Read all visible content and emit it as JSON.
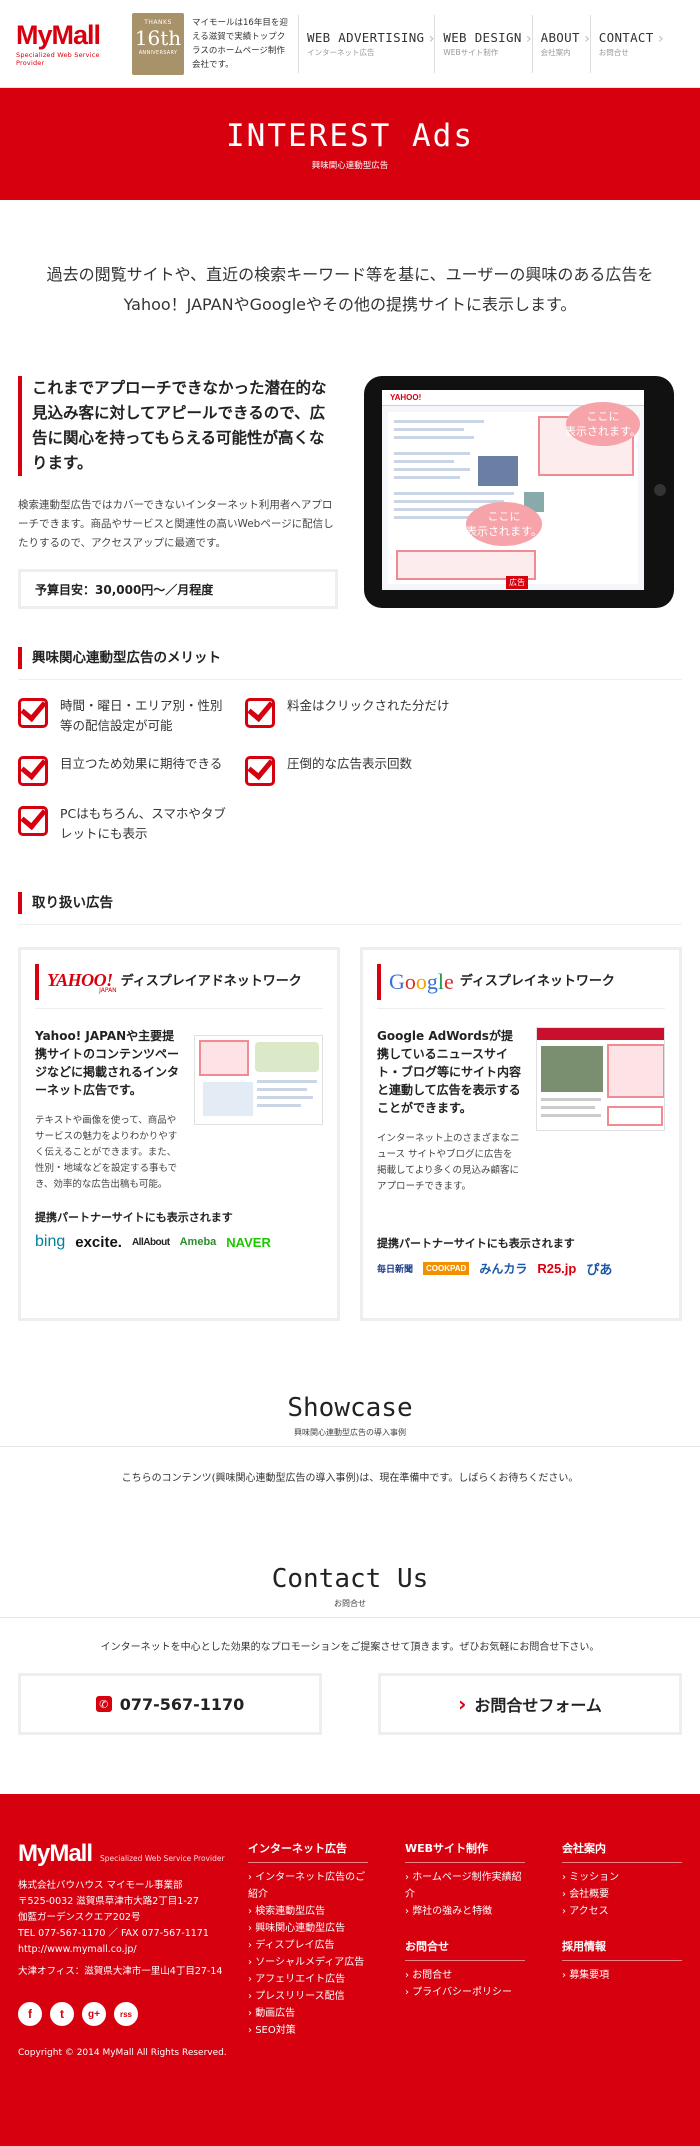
{
  "header": {
    "logo": "MyMall",
    "logo_tagline": "Specialized Web Service Provider",
    "badge": {
      "line1": "THANKS",
      "number": "16th",
      "line3": "ANNIVERSARY"
    },
    "description": "マイモールは16年目を迎える滋賀で実績トップクラスのホームページ制作会社です。",
    "nav": [
      {
        "en": "WEB ADVERTISING",
        "ja": "インターネット広告"
      },
      {
        "en": "WEB DESIGN",
        "ja": "WEBサイト制作"
      },
      {
        "en": "ABOUT",
        "ja": "会社案内"
      },
      {
        "en": "CONTACT",
        "ja": "お問合せ"
      }
    ]
  },
  "hero": {
    "title": "INTEREST Ads",
    "subtitle": "興味関心連動型広告"
  },
  "lead": {
    "line1": "過去の閲覧サイトや、直近の検索キーワード等を基に、ユーザーの興味のある広告を",
    "line2": "Yahoo！JAPANやGoogleやその他の提携サイトに表示します。"
  },
  "intro": {
    "heading": "これまでアプローチできなかった潜在的な見込み客に対してアピールできるので、広告に関心を持ってもらえる可能性が高くなります。",
    "text": "検索連動型広告ではカバーできないインターネット利用者へアプローチできます。商品やサービスと関連性の高いWebページに配信したりするので、アクセスアップに最適です。",
    "budget": "予算目安：30,000円〜／月程度",
    "bubble1": "ここに\n表示されます。",
    "bubble2": "ここに\n表示されます。",
    "ad_tag": "広告"
  },
  "merits": {
    "title": "興味関心連動型広告のメリット",
    "items": [
      "時間・曜日・エリア別・性別等の配信設定が可能",
      "料金はクリックされた分だけ",
      "目立つため効果に期待できる",
      "圧倒的な広告表示回数",
      "PCはもちろん、スマホやタブレットにも表示"
    ]
  },
  "handling": {
    "title": "取り扱い広告",
    "yahoo": {
      "logo": "YAHOO!",
      "logo_sub": "JAPAN",
      "title": "ディスプレイアドネットワーク",
      "strong": "Yahoo! JAPANや主要提携サイトのコンテンツページなどに掲載されるインターネット広告です。",
      "small": "テキストや画像を使って、商品やサービスの魅力をよりわかりやすく伝えることができます。また、性別・地域などを設定する事もでき、効率的な広告出稿も可能。",
      "partners_title": "提携パートナーサイトにも表示されます",
      "partners": [
        "bing",
        "excite.",
        "AllAbout",
        "Ameba",
        "NAVER"
      ]
    },
    "google": {
      "logo": "Google",
      "title": "ディスプレイネットワーク",
      "strong": "Google AdWordsが提携しているニュースサイト・ブログ等にサイト内容と連動して広告を表示することができます。",
      "small": "インターネット上のさまざまなニュース サイトやブログに広告を掲載してより多くの見込み顧客にアプローチできます。",
      "partners_title": "提携パートナーサイトにも表示されます",
      "partners": [
        "毎日新聞",
        "COOKPAD",
        "みんカラ",
        "R25.jp",
        "ぴあ"
      ]
    }
  },
  "showcase": {
    "title": "Showcase",
    "subtitle": "興味関心連動型広告の導入事例",
    "text": "こちらのコンテンツ(興味関心連動型広告の導入事例)は、現在準備中です。しばらくお待ちください。"
  },
  "contact": {
    "title": "Contact Us",
    "subtitle": "お問合せ",
    "text": "インターネットを中心とした効果的なプロモーションをご提案させて頂きます。ぜひお気軽にお問合せ下さい。",
    "phone": "077-567-1170",
    "form": "お問合せフォーム"
  },
  "footer": {
    "logo": "MyMall",
    "tagline": "Specialized Web Service Provider",
    "address": [
      "株式会社バウハウス マイモール事業部",
      "〒525-0032 滋賀県草津市大路2丁目1-27",
      "伽藍ガーデンスクエア202号",
      "TEL 077-567-1170 ／ FAX 077-567-1171",
      "http://www.mymall.co.jp/"
    ],
    "office": "大津オフィス：滋賀県大津市一里山4丁目27-14",
    "social": [
      "f",
      "t",
      "g+",
      "rss"
    ],
    "copyright": "Copyright © 2014 MyMall All Rights Reserved.",
    "col1": {
      "title": "インターネット広告",
      "items": [
        "インターネット広告のご紹介",
        "検索連動型広告",
        "興味関心連動型広告",
        "ディスプレイ広告",
        "ソーシャルメディア広告",
        "アフェリエイト広告",
        "プレスリリース配信",
        "動画広告",
        "SEO対策"
      ]
    },
    "col2": {
      "title": "WEBサイト制作",
      "items": [
        "ホームページ制作実績紹介",
        "弊社の強みと特徴"
      ]
    },
    "col2b": {
      "title": "お問合せ",
      "items": [
        "お問合せ",
        "プライバシーポリシー"
      ]
    },
    "col3": {
      "title": "会社案内",
      "items": [
        "ミッション",
        "会社概要",
        "アクセス"
      ]
    },
    "col3b": {
      "title": "採用情報",
      "items": [
        "募集要項"
      ]
    }
  }
}
